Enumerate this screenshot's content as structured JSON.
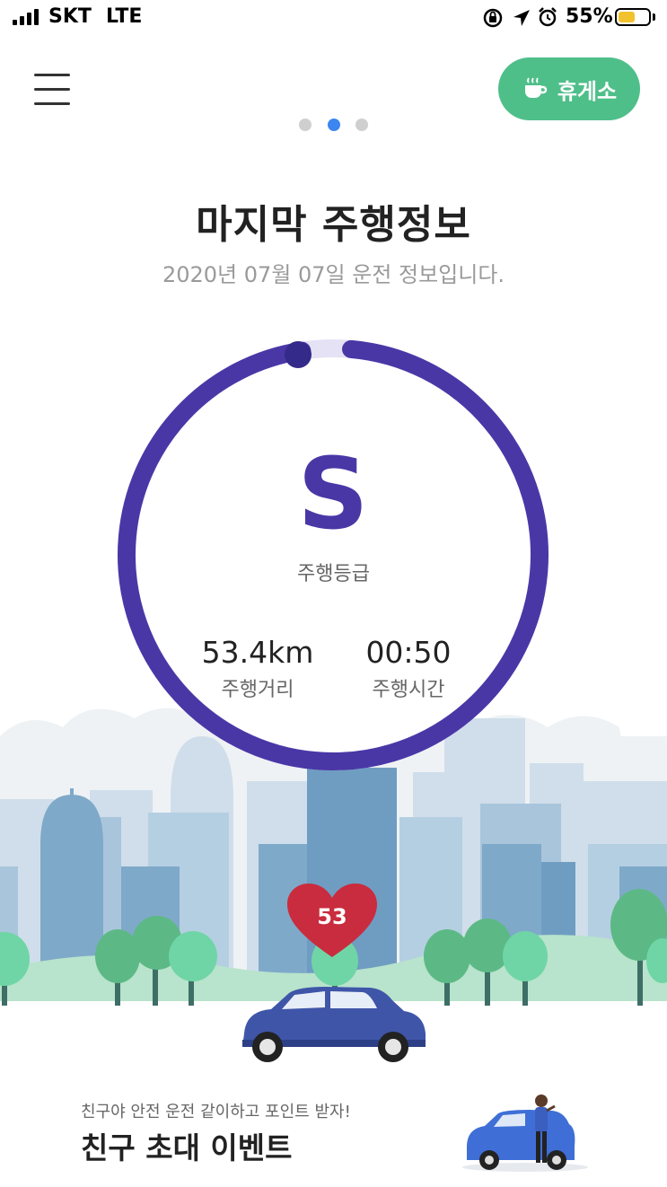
{
  "status_bar": {
    "carrier": "SKT",
    "network": "LTE",
    "battery_percent": "55%",
    "battery_level": 0.55,
    "icons": [
      "signal-icon",
      "orientation-lock-icon",
      "location-arrow-icon",
      "alarm-icon",
      "battery-icon"
    ]
  },
  "header": {
    "menu_icon": "hamburger-menu-icon",
    "rest_area_icon": "coffee-cup-icon",
    "rest_area_label": "휴게소",
    "page_indicator": {
      "total": 3,
      "active": 2
    }
  },
  "title": "마지막 주행정보",
  "subtitle": "2020년 07월 07일 운전 정보입니다.",
  "drive": {
    "grade": "S",
    "grade_label": "주행등급",
    "distance_value": "53.4km",
    "distance_label": "주행거리",
    "time_value": "00:50",
    "time_label": "주행시간",
    "heart_score": "53"
  },
  "event": {
    "subtitle": "친구야 안전 운전 같이하고 포인트 받자!",
    "title": "친구 초대 이벤트"
  },
  "colors": {
    "ring": "#4a37a6",
    "accent_green": "#4fbf8a",
    "active_dot": "#3b86f0",
    "heart": "#c92c3e",
    "car": "#3f55a8"
  }
}
